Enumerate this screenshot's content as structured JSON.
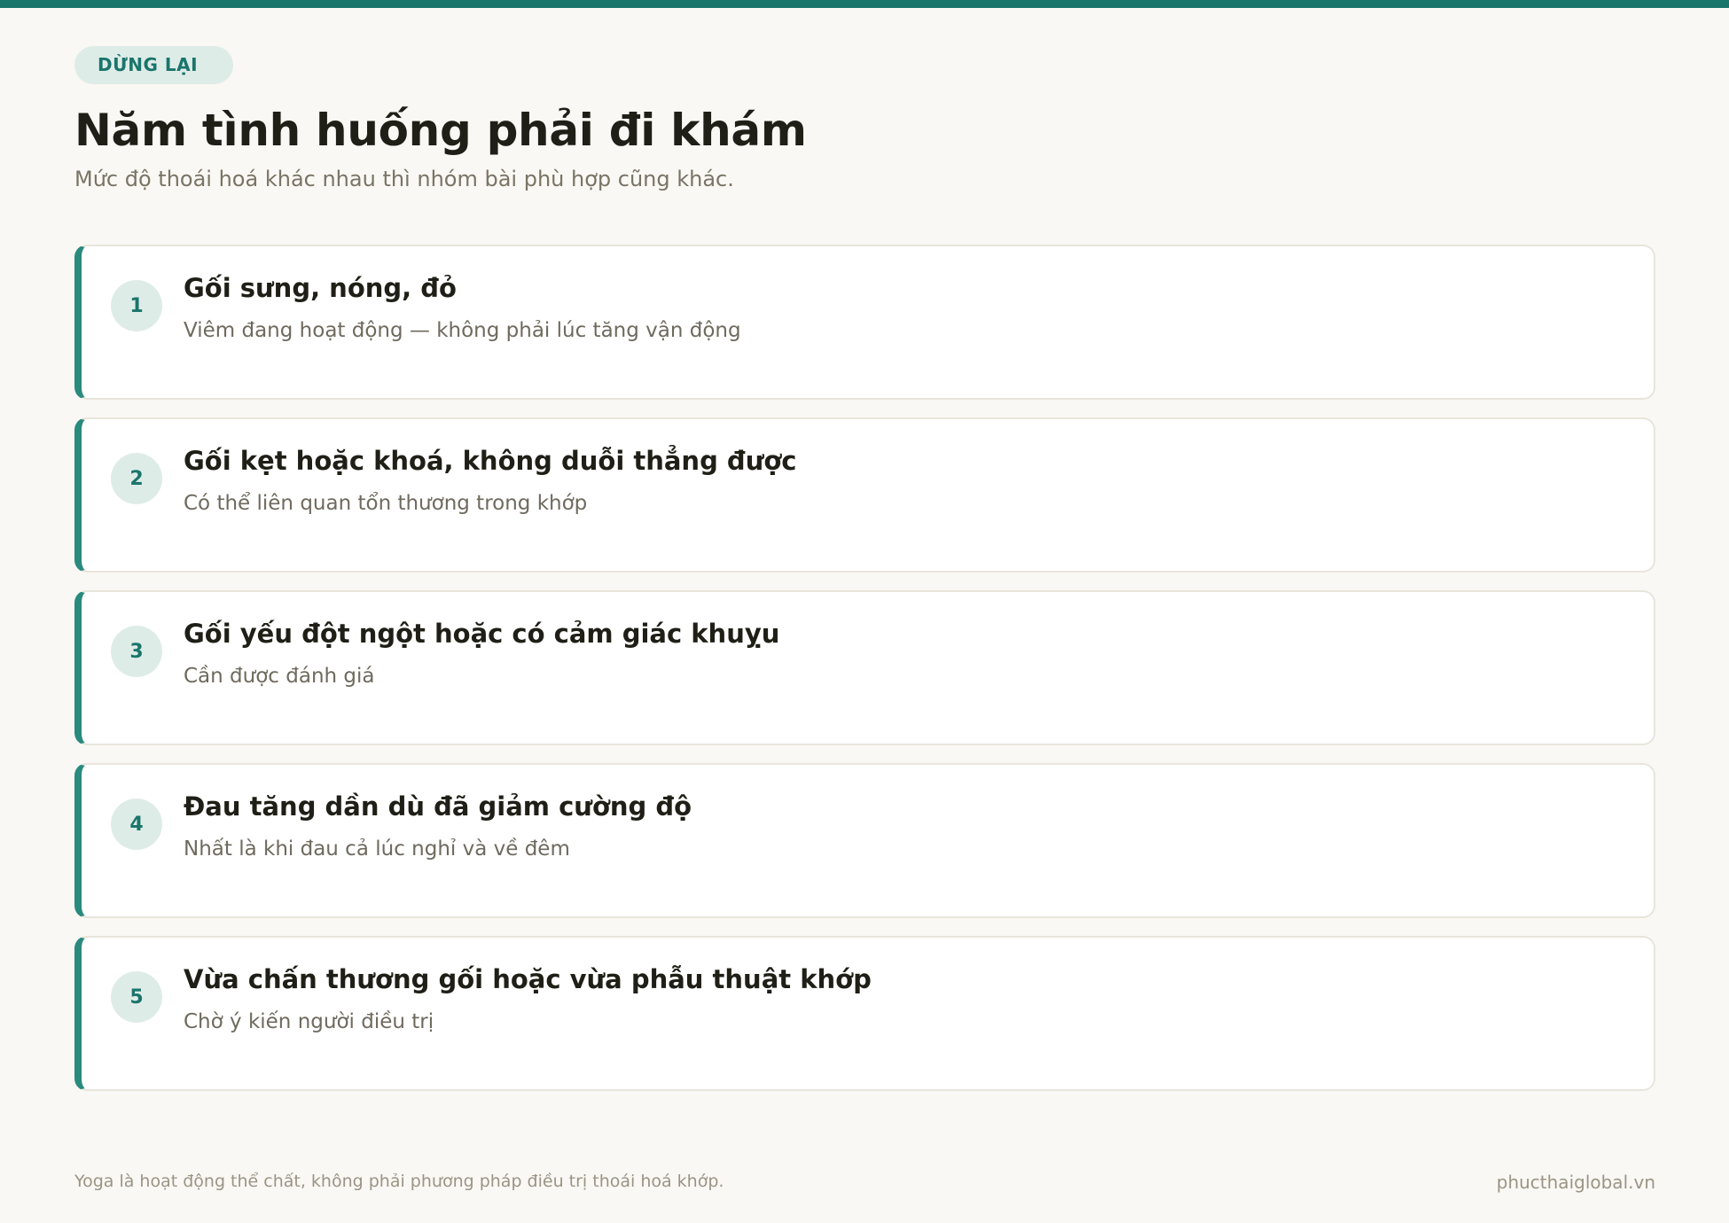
{
  "colors": {
    "accent": "#1a756b",
    "accent_bar": "#2a8a7e",
    "badge_bg": "#deece8",
    "background": "#faf8f4",
    "card_bg": "#ffffff"
  },
  "header": {
    "tag": "DỪNG LẠI",
    "title": "Năm tình huống phải đi khám",
    "subtitle": "Mức độ thoái hoá khác nhau thì nhóm bài phù hợp cũng khác."
  },
  "items": [
    {
      "number": "1",
      "title": "Gối sưng, nóng, đỏ",
      "description": "Viêm đang hoạt động — không phải lúc tăng vận động"
    },
    {
      "number": "2",
      "title": "Gối kẹt hoặc khoá, không duỗi thẳng được",
      "description": "Có thể liên quan tổn thương trong khớp"
    },
    {
      "number": "3",
      "title": "Gối yếu đột ngột hoặc có cảm giác khuỵu",
      "description": "Cần được đánh giá"
    },
    {
      "number": "4",
      "title": "Đau tăng dần dù đã giảm cường độ",
      "description": "Nhất là khi đau cả lúc nghỉ và về đêm"
    },
    {
      "number": "5",
      "title": "Vừa chấn thương gối hoặc vừa phẫu thuật khớp",
      "description": "Chờ ý kiến người điều trị"
    }
  ],
  "footer": {
    "disclaimer": "Yoga là hoạt động thể chất, không phải phương pháp điều trị thoái hoá khớp.",
    "site": "phucthaiglobal.vn"
  }
}
